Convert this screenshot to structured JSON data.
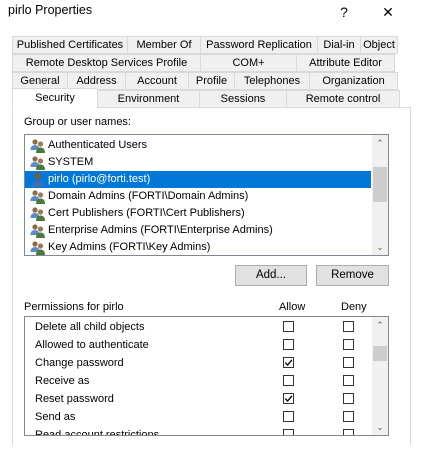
{
  "window": {
    "title": "pirlo Properties",
    "help_label": "?",
    "close_label": "✕"
  },
  "tabs": {
    "row1": [
      "Published Certificates",
      "Member Of",
      "Password Replication",
      "Dial-in",
      "Object"
    ],
    "row2": [
      "Remote Desktop Services Profile",
      "COM+",
      "Attribute Editor"
    ],
    "row3": [
      "General",
      "Address",
      "Account",
      "Profile",
      "Telephones",
      "Organization"
    ],
    "row4": [
      "Security",
      "Environment",
      "Sessions",
      "Remote control"
    ],
    "active": "Security"
  },
  "security": {
    "group_label": "Group or user names:",
    "users": [
      {
        "name": "Authenticated Users",
        "icon": "group-users-icon"
      },
      {
        "name": "SYSTEM",
        "icon": "group-users-icon"
      },
      {
        "name": "pirlo (pirlo@forti.test)",
        "icon": "single-user-icon",
        "selected": true
      },
      {
        "name": "Domain Admins (FORTI\\Domain Admins)",
        "icon": "group-users-icon"
      },
      {
        "name": "Cert Publishers (FORTI\\Cert Publishers)",
        "icon": "group-users-icon"
      },
      {
        "name": "Enterprise Admins (FORTI\\Enterprise Admins)",
        "icon": "group-users-icon"
      },
      {
        "name": "Key Admins (FORTI\\Key Admins)",
        "icon": "group-users-icon"
      }
    ],
    "add_label": "Add...",
    "remove_label": "Remove",
    "permissions_label": "Permissions for pirlo",
    "allow_header": "Allow",
    "deny_header": "Deny",
    "permissions": [
      {
        "name": "Delete all child objects",
        "allow": false,
        "deny": false
      },
      {
        "name": "Allowed to authenticate",
        "allow": false,
        "deny": false
      },
      {
        "name": "Change password",
        "allow": true,
        "deny": false
      },
      {
        "name": "Receive as",
        "allow": false,
        "deny": false
      },
      {
        "name": "Reset password",
        "allow": true,
        "deny": false
      },
      {
        "name": "Send as",
        "allow": false,
        "deny": false
      },
      {
        "name": "Read account restrictions",
        "allow": false,
        "deny": false
      }
    ]
  },
  "colors": {
    "selection": "#0078d7",
    "tab_bg": "#f0f0f0",
    "button_bg": "#e1e1e1"
  }
}
